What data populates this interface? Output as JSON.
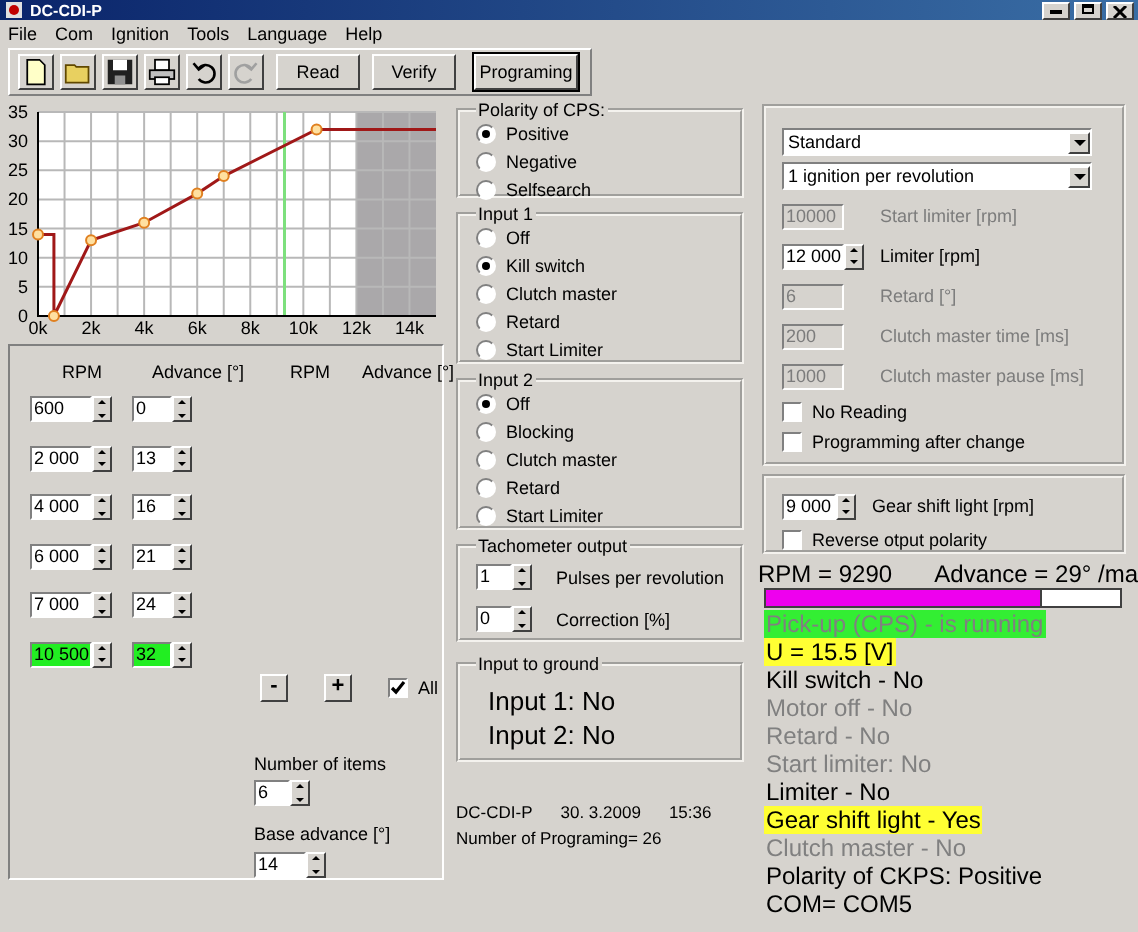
{
  "window": {
    "title": "DC-CDI-P"
  },
  "menu": [
    "File",
    "Com",
    "Ignition",
    "Tools",
    "Language",
    "Help"
  ],
  "toolbar": {
    "icons": [
      {
        "kind": "new",
        "disabled": false
      },
      {
        "kind": "open",
        "disabled": false
      },
      {
        "kind": "save",
        "disabled": false
      },
      {
        "kind": "print",
        "disabled": false
      },
      {
        "kind": "undo",
        "disabled": false
      },
      {
        "kind": "redo",
        "disabled": true
      }
    ],
    "buttons": [
      {
        "label": "Read",
        "default": false
      },
      {
        "label": "Verify",
        "default": false
      },
      {
        "label": "Programing",
        "default": true
      }
    ]
  },
  "chart": {
    "chart_data": {
      "type": "line",
      "x": [
        0,
        600,
        600,
        2000,
        4000,
        6000,
        7000,
        10500,
        15000
      ],
      "grid": true,
      "series": [
        {
          "color": "#a01818",
          "values": [
            14,
            14,
            0,
            13,
            16,
            21,
            24,
            32,
            32
          ]
        }
      ],
      "xlim": [
        0,
        15000
      ],
      "ylim": [
        0,
        35
      ],
      "xticks": [
        {
          "value": 0,
          "label": "0k"
        },
        {
          "value": 2000,
          "label": "2k"
        },
        {
          "value": 4000,
          "label": "4k"
        },
        {
          "value": 6000,
          "label": "6k"
        },
        {
          "value": 8000,
          "label": "8k"
        },
        {
          "value": 10000,
          "label": "10k"
        },
        {
          "value": 12000,
          "label": "12k"
        },
        {
          "value": 14000,
          "label": "14k"
        }
      ],
      "yticks": [
        0,
        5,
        10,
        15,
        20,
        25,
        30,
        35
      ],
      "bands": [
        {
          "axis": "x",
          "from": 12000,
          "to": 15000
        }
      ],
      "ref_lines": [
        {
          "axis": "x",
          "value": 9290
        }
      ]
    }
  },
  "curve_table": {
    "columns": [
      "RPM",
      "Advance [°]",
      "RPM",
      "Advance [°]"
    ],
    "rows": [
      {
        "rpm": "600",
        "advance": "0",
        "selected": false
      },
      {
        "rpm": "2 000",
        "advance": "13",
        "selected": false
      },
      {
        "rpm": "4 000",
        "advance": "16",
        "selected": false
      },
      {
        "rpm": "6 000",
        "advance": "21",
        "selected": false
      },
      {
        "rpm": "7 000",
        "advance": "24",
        "selected": false
      },
      {
        "rpm": "10 500",
        "advance": "32",
        "selected": true
      }
    ],
    "remove_button": "-",
    "add_button": "+",
    "all": {
      "label": "All",
      "checked": true
    },
    "items_count": {
      "label": "Number of items",
      "value": "6"
    },
    "base_advance": {
      "label": "Base advance [°]",
      "value": "14"
    }
  },
  "polarity": {
    "title": "Polarity of CPS:",
    "options": [
      {
        "label": "Positive",
        "selected": true
      },
      {
        "label": "Negative",
        "selected": false
      },
      {
        "label": "Selfsearch",
        "selected": false
      }
    ]
  },
  "input_1": {
    "title": "Input 1",
    "options": [
      {
        "label": "Off",
        "selected": false
      },
      {
        "label": "Kill switch",
        "selected": true
      },
      {
        "label": "Clutch master",
        "selected": false
      },
      {
        "label": "Retard",
        "selected": false
      },
      {
        "label": "Start Limiter",
        "selected": false
      }
    ]
  },
  "input_2": {
    "title": "Input 2",
    "options": [
      {
        "label": "Off",
        "selected": true
      },
      {
        "label": "Blocking",
        "selected": false
      },
      {
        "label": "Clutch master",
        "selected": false
      },
      {
        "label": "Retard",
        "selected": false
      },
      {
        "label": "Start Limiter",
        "selected": false
      }
    ]
  },
  "tachometer": {
    "title": "Tachometer output",
    "fields": [
      {
        "value": "1",
        "label": "Pulses per revolution"
      },
      {
        "value": "0",
        "label": "Correction [%]"
      }
    ]
  },
  "input_to_ground": {
    "title": "Input to ground",
    "lines": [
      "Input 1: No",
      "Input 2: No"
    ]
  },
  "info": {
    "device": "DC-CDI-P",
    "date": "30. 3.2009",
    "time": "15:36",
    "programming_count": "Number of Programing= 26"
  },
  "settings": {
    "selects": [
      "Standard",
      "1 ignition per revolution"
    ],
    "fields": [
      {
        "kind": "text",
        "value": "10000",
        "label": "Start limiter [rpm]",
        "disabled": true
      },
      {
        "kind": "spin",
        "value": "12 000",
        "label": "Limiter [rpm]",
        "disabled": false
      },
      {
        "kind": "text",
        "value": "6",
        "label": "Retard [°]",
        "disabled": true
      },
      {
        "kind": "text",
        "value": "200",
        "label": "Clutch master time [ms]",
        "disabled": true
      },
      {
        "kind": "text",
        "value": "1000",
        "label": "Clutch master pause [ms]",
        "disabled": true
      }
    ],
    "checkboxes": [
      {
        "label": "No Reading",
        "checked": false
      },
      {
        "label": "Programming after change",
        "checked": false
      }
    ]
  },
  "gear": {
    "field": {
      "value": "9 000",
      "label": "Gear shift light [rpm]"
    },
    "checkbox": {
      "label": "Reverse otput polarity",
      "checked": false
    }
  },
  "status": {
    "rpm": "RPM = 9290",
    "advance": "Advance = 29° /ma",
    "level": 0.78,
    "lines": [
      {
        "text": "Pick-up (CPS) - is running",
        "color": "#33ee33",
        "disabled": true
      },
      {
        "text": "U = 15.5 [V]",
        "color": "#ffff33",
        "disabled": false
      },
      {
        "text": "Kill switch - No",
        "disabled": false
      },
      {
        "text": "Motor off - No",
        "disabled": true
      },
      {
        "text": "Retard - No",
        "disabled": true
      },
      {
        "text": "Start limiter: No",
        "disabled": true
      },
      {
        "text": "Limiter - No",
        "disabled": false
      },
      {
        "text": "Gear shift light - Yes",
        "color": "#ffff33",
        "disabled": false
      },
      {
        "text": "Clutch master - No",
        "disabled": true
      },
      {
        "text": "Polarity of CKPS: Positive",
        "disabled": false
      },
      {
        "text": "COM= COM5",
        "disabled": false
      }
    ]
  }
}
